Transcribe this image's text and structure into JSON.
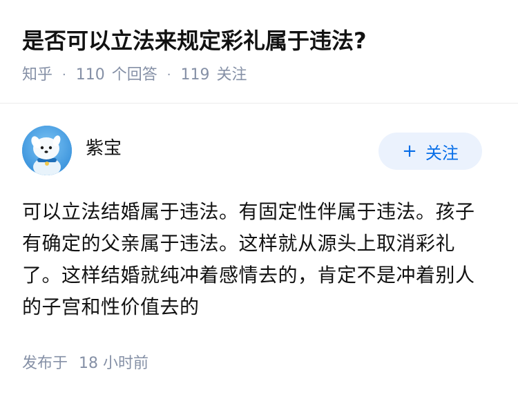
{
  "question": {
    "title": "是否可以立法来规定彩礼属于违法?",
    "source": "知乎",
    "answer_count": "110",
    "answer_label": "个回答",
    "follower_count": "119",
    "follower_label": "关注",
    "separator": "·"
  },
  "answer": {
    "author": "紫宝",
    "avatar_icon": "avatar-cartoon-dog-icon",
    "follow_button": {
      "icon": "plus-icon",
      "plus": "+",
      "label": "关注"
    },
    "content": "可以立法结婚属于违法。有固定性伴属于违法。孩子有确定的父亲属于违法。这样就从源头上取消彩礼了。这样结婚就纯冲着感情去的，肯定不是冲着别人的子宫和性价值去的",
    "published_prefix": "发布于",
    "published_num": "18",
    "published_unit": "小时前"
  },
  "colors": {
    "accent": "#056de8",
    "accent_bg": "#ebf2fd",
    "meta": "#8590a6",
    "text": "#121212"
  }
}
